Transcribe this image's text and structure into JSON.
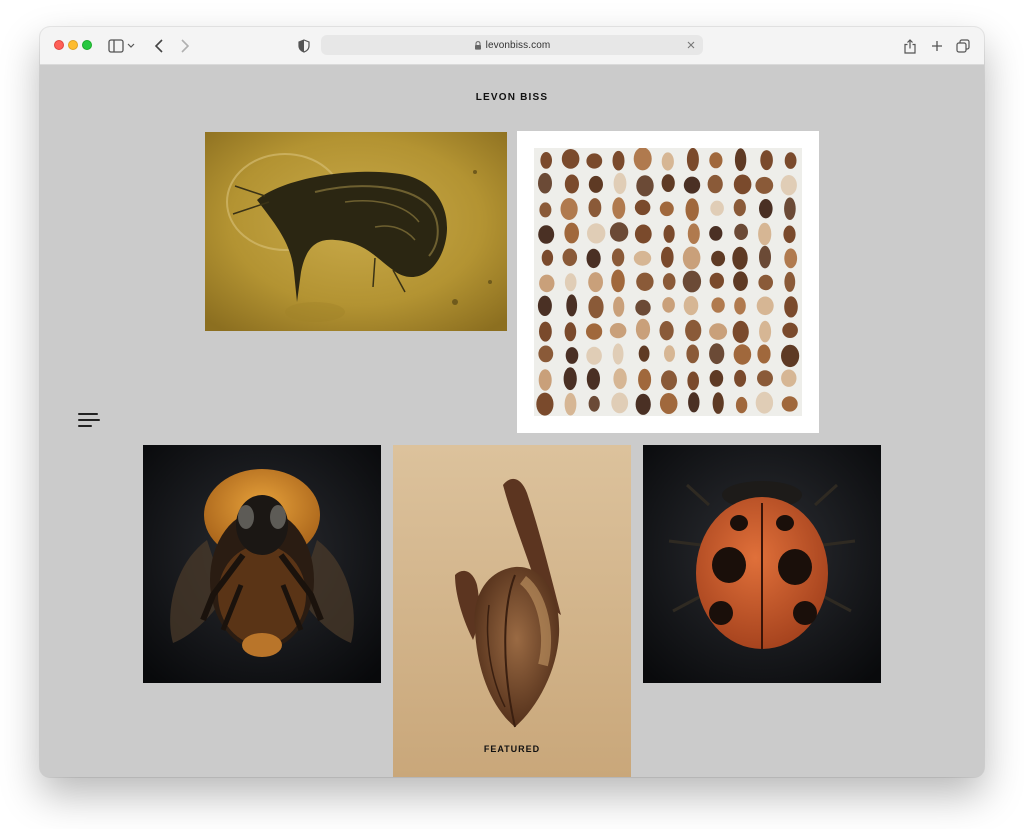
{
  "browser": {
    "url": "levonbiss.com",
    "icons": {
      "sidebar": "sidebar-icon",
      "back": "chevron-left-icon",
      "forward": "chevron-right-icon",
      "privacy": "shield-icon",
      "lock": "lock-icon",
      "clear": "close-icon",
      "share": "share-icon",
      "new_tab": "plus-icon",
      "tabs": "tabs-overview-icon"
    }
  },
  "site": {
    "title": "LEVON BISS",
    "menu_icon": "hamburger-menu-icon",
    "gallery": [
      {
        "name": "amber-insect-image"
      },
      {
        "name": "seed-collection-image"
      },
      {
        "name": "bumblebee-image"
      },
      {
        "name": "seed-pod-image",
        "label": "FEATURED"
      },
      {
        "name": "ladybird-image"
      }
    ]
  },
  "colors": {
    "page_background": "#cbcbcb",
    "toolbar_background": "#f4f4f4",
    "text": "#111111"
  }
}
